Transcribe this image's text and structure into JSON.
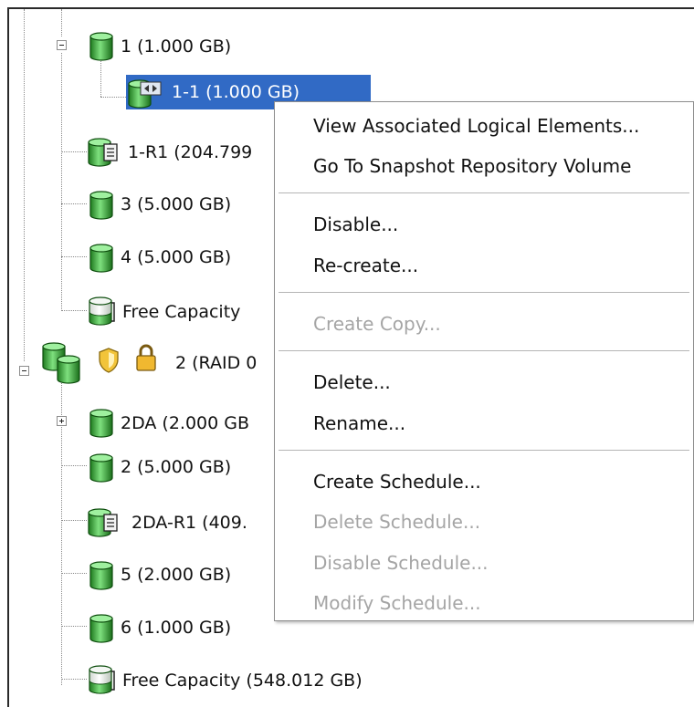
{
  "tree": {
    "items": [
      {
        "label": "1 (1.000 GB)"
      },
      {
        "label": "1-1 (1.000 GB)"
      },
      {
        "label": "1-R1 (204.799"
      },
      {
        "label": "3 (5.000 GB)"
      },
      {
        "label": "4 (5.000 GB)"
      },
      {
        "label": "Free Capacity"
      },
      {
        "label": "2 (RAID 0"
      },
      {
        "label": "2DA (2.000 GB"
      },
      {
        "label": "2 (5.000 GB)"
      },
      {
        "label": "2DA-R1 (409."
      },
      {
        "label": "5 (2.000 GB)"
      },
      {
        "label": "6 (1.000 GB)"
      },
      {
        "label": "Free Capacity (548.012 GB)"
      }
    ]
  },
  "context_menu": {
    "items": [
      {
        "label": "View Associated Logical Elements...",
        "enabled": true
      },
      {
        "label": "Go To Snapshot Repository Volume",
        "enabled": true
      },
      {
        "label": "Disable...",
        "enabled": true
      },
      {
        "label": "Re-create...",
        "enabled": true
      },
      {
        "label": "Create Copy...",
        "enabled": false
      },
      {
        "label": "Delete...",
        "enabled": true
      },
      {
        "label": "Rename...",
        "enabled": true
      },
      {
        "label": "Create Schedule...",
        "enabled": true
      },
      {
        "label": "Delete Schedule...",
        "enabled": false
      },
      {
        "label": "Disable Schedule...",
        "enabled": false
      },
      {
        "label": "Modify Schedule...",
        "enabled": false
      }
    ]
  },
  "colors": {
    "selection": "#316ac5",
    "volume_green": "#2e9a2e",
    "disabled_text": "#a5a5a5"
  }
}
